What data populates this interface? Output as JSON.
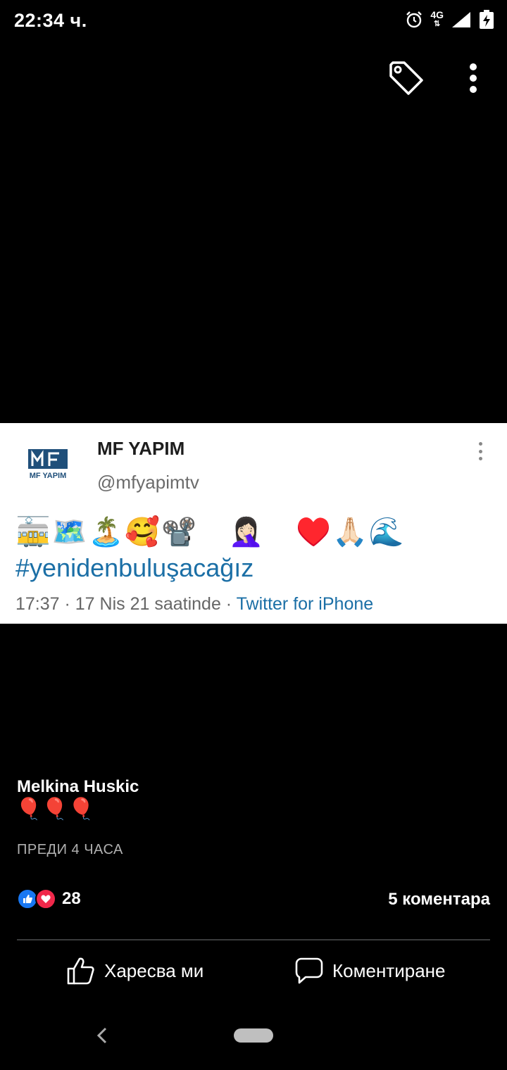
{
  "status_bar": {
    "time": "22:34 ч.",
    "network": "4G",
    "icons": [
      "alarm-icon",
      "signal-icon",
      "battery-charging-icon"
    ]
  },
  "toolbar": {
    "icons": [
      "tag-icon",
      "more-vertical-icon"
    ]
  },
  "tweet": {
    "logo_text": "MF YAPIM",
    "name": "MF YAPIM",
    "handle": "@mfyapimtv",
    "emojis": "🚋🗺️🏝️🥰📽️😨🤦🏻‍♀️😎♥️🙏🏻🌊😓😂",
    "hashtag": "#yenidenbuluşacağız",
    "meta_time": "17:37 · 17 Nis 21 saatinde · ",
    "meta_source": "Twitter for iPhone"
  },
  "post": {
    "author": "Melkina Huskic",
    "text": "🎈🎈🎈",
    "time": "ПРЕДИ 4 ЧАСА",
    "reaction_count": "28",
    "comment_count": "5 коментара",
    "like_label": "Харесва ми",
    "comment_label": "Коментиране"
  },
  "colors": {
    "background": "#000000",
    "facebook_blue": "#1877f2",
    "love_red": "#f0284a",
    "twitter_link": "#1b6fa6"
  }
}
